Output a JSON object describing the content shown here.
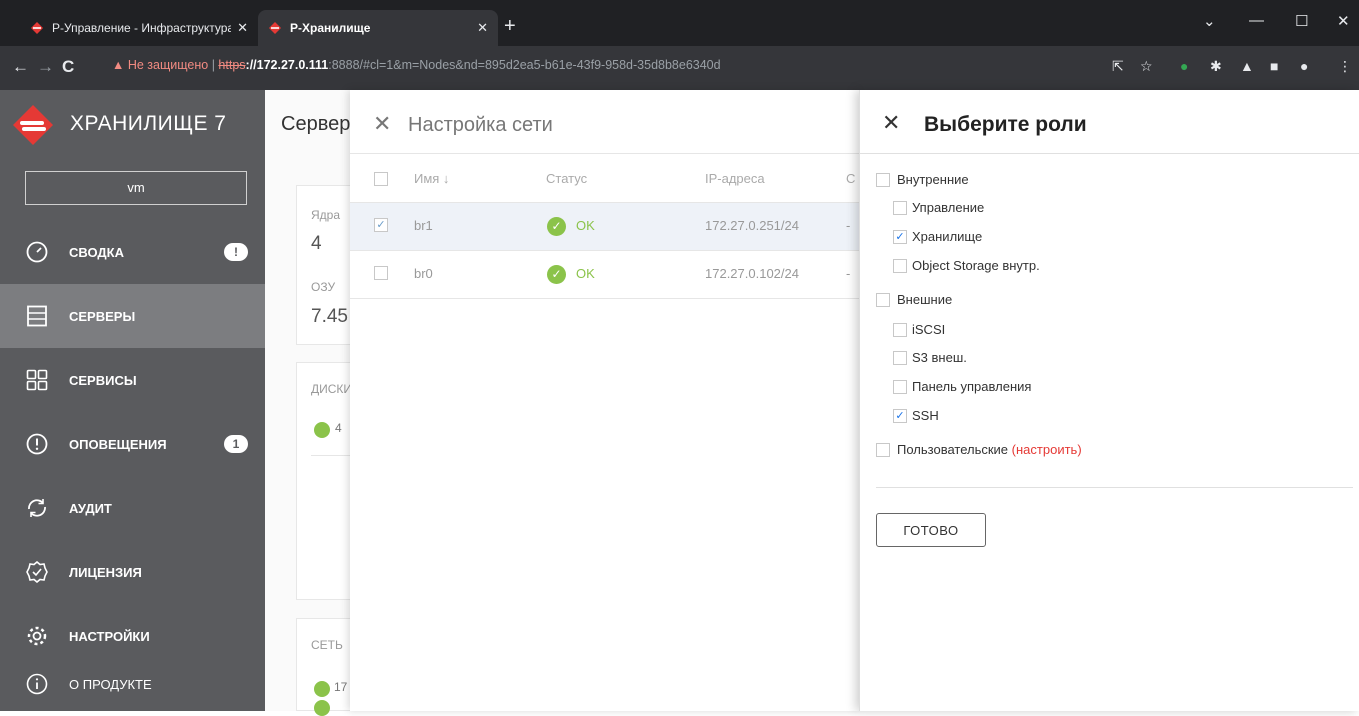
{
  "browser": {
    "tabs": [
      {
        "title": "Р-Управление - Инфраструктура",
        "close": "✕"
      },
      {
        "title": "Р-Хранилище",
        "close": "✕"
      }
    ],
    "new_tab": "+",
    "security_label": "Не защищено",
    "url_scheme": "https",
    "url_host": "://172.27.0.111",
    "url_rest": ":8888/#cl=1&m=Nodes&nd=895d2ea5-b61e-43f9-958d-35d8b8e6340d"
  },
  "sidebar": {
    "brand": "ХРАНИЛИЩЕ 7",
    "node_selector": "vm",
    "items": [
      {
        "label": "СВОДКА",
        "icon": "gauge-icon",
        "badge": "!"
      },
      {
        "label": "СЕРВЕРЫ",
        "icon": "server-icon",
        "active": true
      },
      {
        "label": "СЕРВИСЫ",
        "icon": "grid-icon"
      },
      {
        "label": "ОПОВЕЩЕНИЯ",
        "icon": "alert-icon",
        "badge": "1"
      },
      {
        "label": "АУДИТ",
        "icon": "refresh-icon"
      },
      {
        "label": "ЛИЦЕНЗИЯ",
        "icon": "license-icon"
      },
      {
        "label": "НАСТРОЙКИ",
        "icon": "gear-icon"
      },
      {
        "label": "О ПРОДУКТЕ",
        "icon": "info-icon"
      }
    ]
  },
  "main": {
    "title": "Сервер",
    "cores_label": "Ядра",
    "cores_value": "4",
    "ram_label": "ОЗУ",
    "ram_value": "7.45",
    "disks_label": "ДИСКИ",
    "disks_count": "4",
    "network_label": "СЕТЬ",
    "network_value": "17"
  },
  "network_panel": {
    "title": "Настройка сети",
    "columns": [
      "Имя ↓",
      "Статус",
      "IP-адреса",
      "С"
    ],
    "rows": [
      {
        "name": "br1",
        "status": "OK",
        "ip": "172.27.0.251/24",
        "extra": "-",
        "checked": true
      },
      {
        "name": "br0",
        "status": "OK",
        "ip": "172.27.0.102/24",
        "extra": "-",
        "checked": false
      }
    ]
  },
  "roles_panel": {
    "title": "Выберите роли",
    "groups": [
      {
        "label": "Внутренние",
        "checked": false,
        "items": [
          {
            "label": "Управление",
            "checked": false
          },
          {
            "label": "Хранилище",
            "checked": true
          },
          {
            "label": "Object Storage внутр.",
            "checked": false
          }
        ]
      },
      {
        "label": "Внешние",
        "checked": false,
        "items": [
          {
            "label": "iSCSI",
            "checked": false
          },
          {
            "label": "S3 внеш.",
            "checked": false
          },
          {
            "label": "Панель управления",
            "checked": false
          },
          {
            "label": "SSH",
            "checked": true
          }
        ]
      }
    ],
    "custom_label": "Пользовательские",
    "custom_link": "(настроить)",
    "done_button": "ГОТОВО"
  },
  "colors": {
    "sidebar_bg": "#5a5b5e",
    "sidebar_active": "#7c7d80",
    "ok_green": "#8bc34a",
    "brand_red": "#e53935",
    "check_blue": "#1a73e8"
  }
}
